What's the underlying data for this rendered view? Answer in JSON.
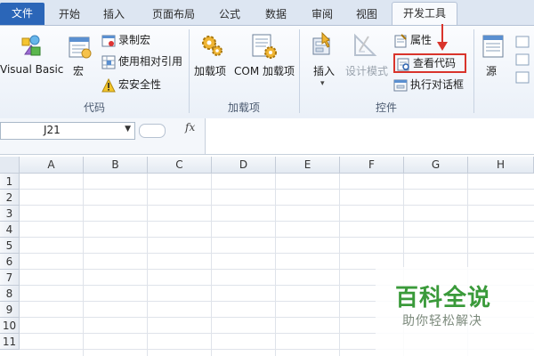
{
  "tabs": [
    "文件",
    "开始",
    "插入",
    "页面布局",
    "公式",
    "数据",
    "审阅",
    "视图",
    "开发工具"
  ],
  "active_tab": "开发工具",
  "groups": {
    "code": {
      "label": "代码",
      "visual_basic": "Visual Basic",
      "macros": "宏",
      "record_macro": "录制宏",
      "relative_refs": "使用相对引用",
      "macro_security": "宏安全性"
    },
    "addins": {
      "label": "加载项",
      "addins_btn": "加载项",
      "com_addins": "COM 加载项"
    },
    "controls": {
      "label": "控件",
      "insert": "插入",
      "design_mode": "设计模式",
      "properties": "属性",
      "view_code": "查看代码",
      "run_dialog": "执行对话框"
    },
    "xml": {
      "source": "源"
    }
  },
  "formula_bar": {
    "name_box": "J21",
    "fx": "fx",
    "formula": ""
  },
  "columns": [
    "A",
    "B",
    "C",
    "D",
    "E",
    "F",
    "G",
    "H"
  ],
  "rows": [
    "1",
    "2",
    "3",
    "4",
    "5",
    "6",
    "7",
    "8",
    "9",
    "10",
    "11"
  ],
  "watermark": {
    "title": "百科全说",
    "subtitle": "助你轻松解决"
  },
  "colors": {
    "file_tab": "#2b66b8",
    "highlight": "#d9342b",
    "watermark_green": "#3a9a3a"
  }
}
